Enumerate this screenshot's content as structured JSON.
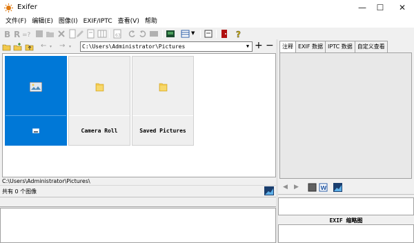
{
  "window": {
    "title": "Exifer"
  },
  "menu": [
    {
      "label": "文件(F)"
    },
    {
      "label": "编辑(E)"
    },
    {
      "label": "图像(I)"
    },
    {
      "label": "EXIF/IPTC"
    },
    {
      "label": "查看(V)"
    },
    {
      "label": "帮助"
    }
  ],
  "address": {
    "path": "C:\\Users\\Administrator\\Pictures"
  },
  "thumbnails": [
    {
      "label": "",
      "kind": "image",
      "selected": true
    },
    {
      "label": "Camera Roll",
      "kind": "folder",
      "selected": false
    },
    {
      "label": "Saved Pictures",
      "kind": "folder",
      "selected": false
    }
  ],
  "status": {
    "path": "C:\\Users\\Administrator\\Pictures\\",
    "count": "共有 0 个图像"
  },
  "tabs": [
    {
      "label": "注释",
      "active": true
    },
    {
      "label": "EXIF 数据",
      "active": false
    },
    {
      "label": "IPTC 数据",
      "active": false
    },
    {
      "label": "自定义查看",
      "active": false
    }
  ],
  "exif_thumb_label": "EXIF 缩略图",
  "colors": {
    "selection": "#0078d7",
    "folder": "#f2c94c"
  }
}
